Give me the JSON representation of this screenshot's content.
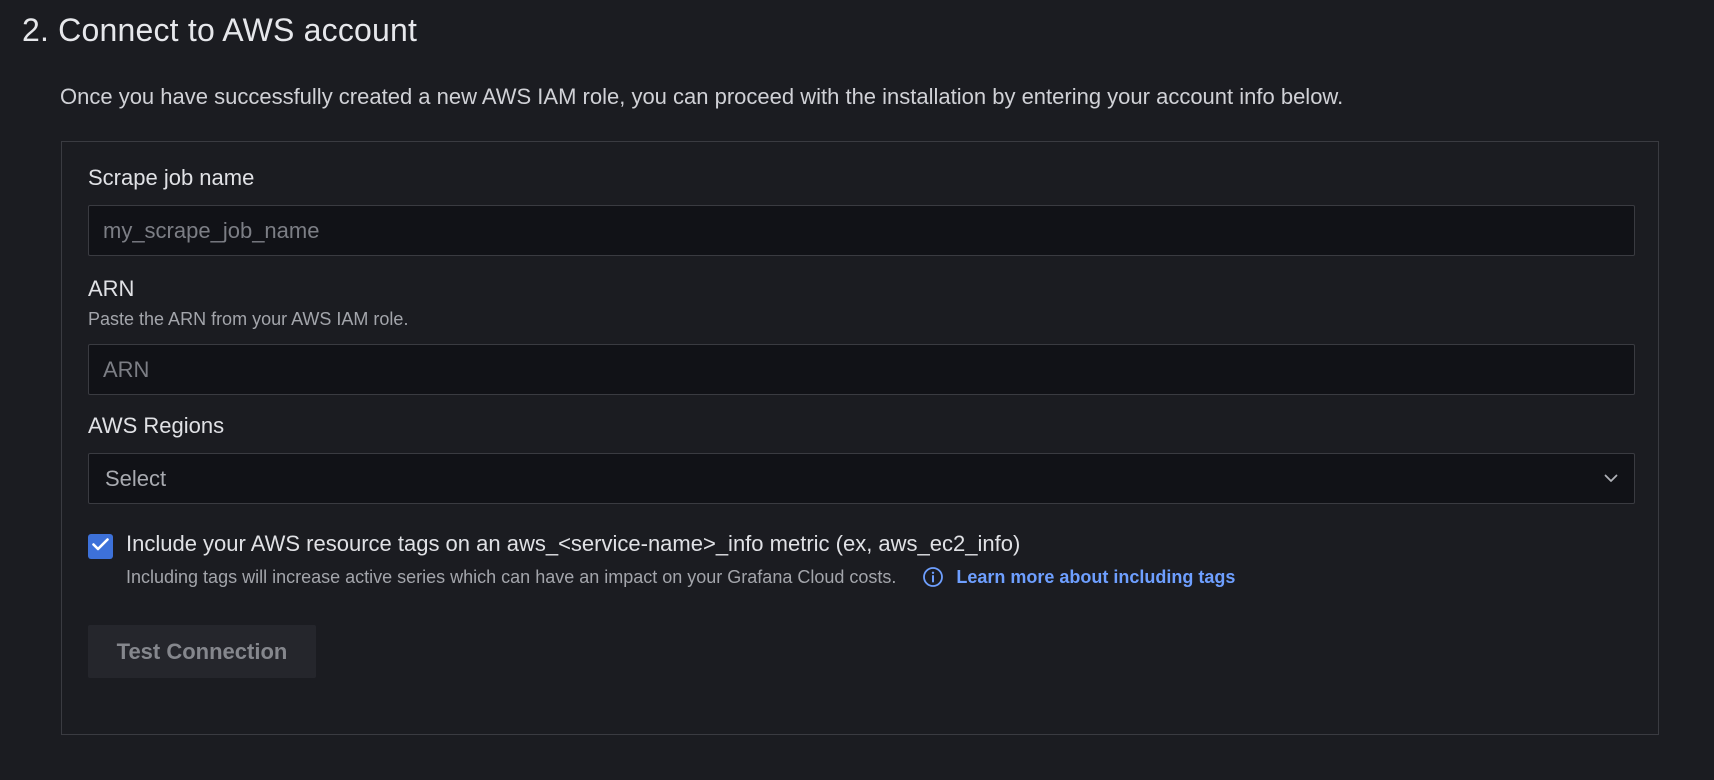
{
  "section": {
    "title": "2. Connect to AWS account",
    "description": "Once you have successfully created a new AWS IAM role, you can proceed with the installation by entering your account info below."
  },
  "form": {
    "scrape_job": {
      "label": "Scrape job name",
      "placeholder": "my_scrape_job_name",
      "value": ""
    },
    "arn": {
      "label": "ARN",
      "hint": "Paste the ARN from your AWS IAM role.",
      "placeholder": "ARN",
      "value": ""
    },
    "regions": {
      "label": "AWS Regions",
      "selected": "Select"
    },
    "tags_checkbox": {
      "checked": true,
      "label": "Include your AWS resource tags on an aws_<service-name>_info metric (ex, aws_ec2_info)",
      "hint": "Including tags will increase active series which can have an impact on your Grafana Cloud costs.",
      "link_text": "Learn more about including tags",
      "info_icon": "info-circle-icon",
      "check_icon": "checkmark-icon"
    },
    "test_button": {
      "label": "Test Connection"
    }
  },
  "colors": {
    "background": "#1b1c21",
    "accent": "#3d71d9",
    "link": "#6e9fff"
  }
}
